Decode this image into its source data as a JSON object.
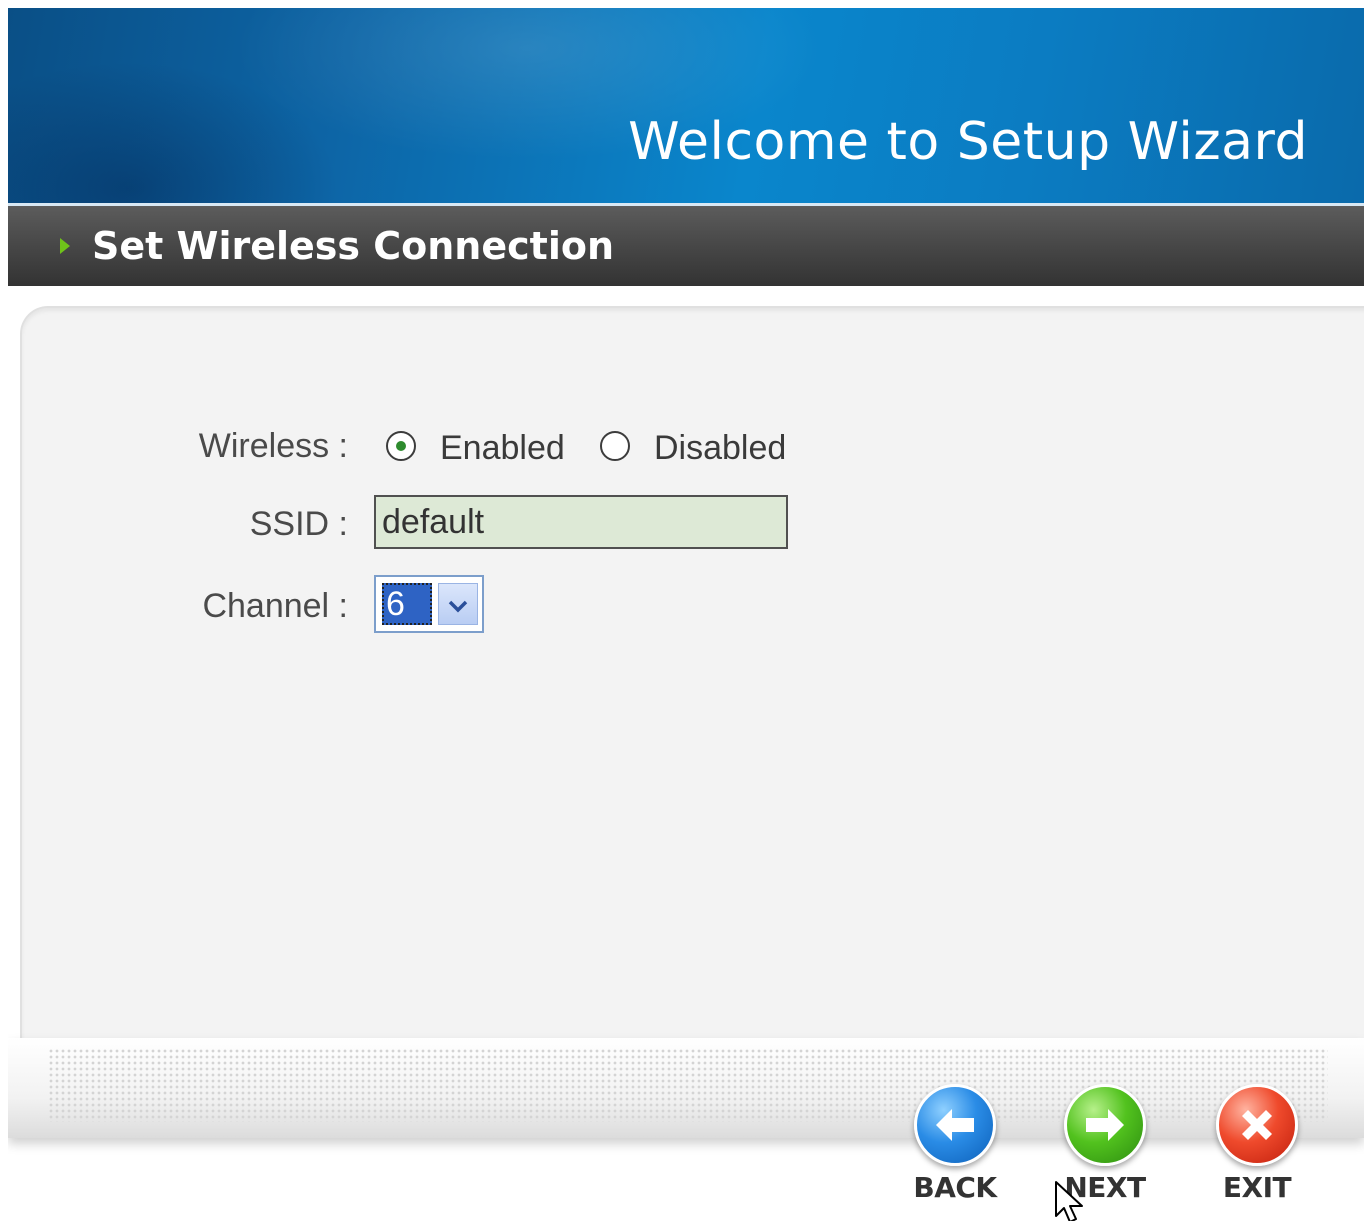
{
  "header": {
    "title": "Welcome to Setup Wizard"
  },
  "section": {
    "title": "Set Wireless Connection"
  },
  "form": {
    "wireless_label": "Wireless :",
    "wireless_options": [
      {
        "label": "Enabled",
        "selected": true
      },
      {
        "label": "Disabled",
        "selected": false
      }
    ],
    "ssid_label": "SSID :",
    "ssid_value": "default",
    "channel_label": "Channel :",
    "channel_value": "6"
  },
  "footer": {
    "back_label": "BACK",
    "next_label": "NEXT",
    "exit_label": "EXIT"
  },
  "colors": {
    "header_blue": "#0a86cc",
    "section_bar": "#474747",
    "accent_green": "#6fc21a",
    "ssid_bg": "#dde9d6"
  },
  "icons": [
    "triangle-arrow-icon",
    "back-arrow-icon",
    "next-arrow-icon",
    "exit-x-icon",
    "mouse-cursor-icon"
  ]
}
